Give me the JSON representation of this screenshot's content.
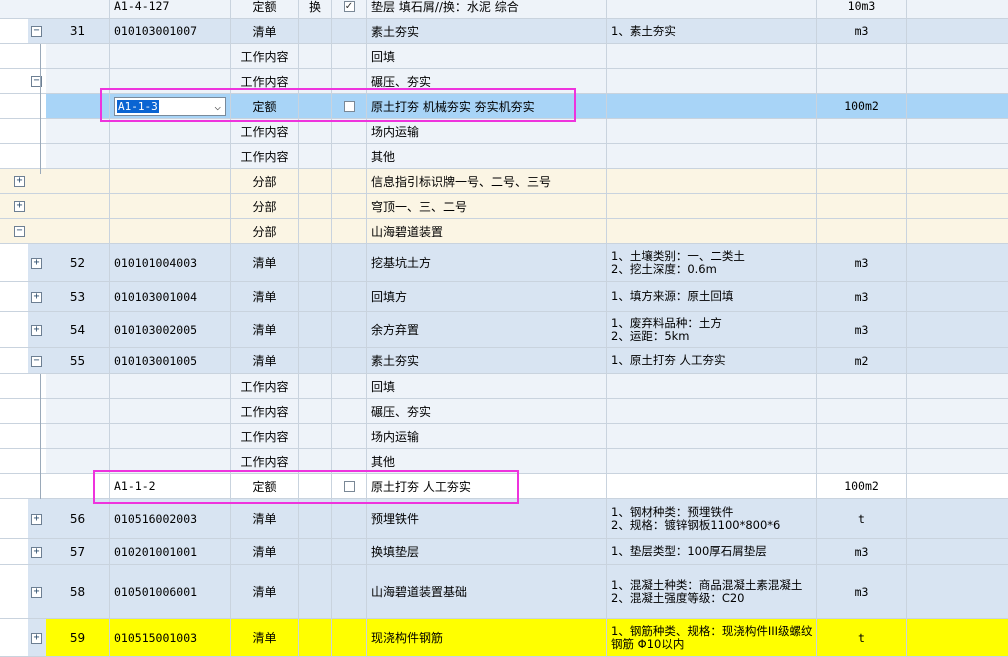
{
  "rows": [
    {
      "seq": "",
      "code": "A1-4-127",
      "type": "定额",
      "swap": "换",
      "checked": true,
      "name": "垫层 填石屑//换：水泥 综合",
      "feat": [
        "",
        ""
      ],
      "unit": "10m3"
    },
    {
      "seq": "31",
      "code": "010103001007",
      "type": "清单",
      "swap": "",
      "name": "素土夯实",
      "feat": [
        "1、素土夯实",
        ""
      ],
      "unit": "m3"
    },
    {
      "type": "工作内容",
      "name": "回填"
    },
    {
      "type": "工作内容",
      "name": "碾压、夯实"
    },
    {
      "combo": "A1-1-3",
      "type": "定额",
      "checked": false,
      "name": "原土打夯 机械夯实 夯实机夯实",
      "unit": "100m2"
    },
    {
      "type": "工作内容",
      "name": "场内运输"
    },
    {
      "type": "工作内容",
      "name": "其他"
    },
    {
      "type": "分部",
      "name": "信息指引标识牌一号、二号、三号"
    },
    {
      "type": "分部",
      "name": "穹顶一、三、二号"
    },
    {
      "type": "分部",
      "name": "山海碧道装置"
    },
    {
      "seq": "52",
      "code": "010101004003",
      "type": "清单",
      "name": "挖基坑土方",
      "feat": [
        "1、土壤类别：一、二类土",
        "2、挖土深度：0.6m"
      ],
      "unit": "m3"
    },
    {
      "seq": "53",
      "code": "010103001004",
      "type": "清单",
      "name": "回填方",
      "feat": [
        "1、填方来源：原土回填",
        ""
      ],
      "unit": "m3"
    },
    {
      "seq": "54",
      "code": "010103002005",
      "type": "清单",
      "name": "余方弃置",
      "feat": [
        "1、废弃料品种：土方",
        "2、运距：5km"
      ],
      "unit": "m3"
    },
    {
      "seq": "55",
      "code": "010103001005",
      "type": "清单",
      "name": "素土夯实",
      "feat": [
        "1、原土打夯 人工夯实",
        ""
      ],
      "unit": "m2"
    },
    {
      "type": "工作内容",
      "name": "回填"
    },
    {
      "type": "工作内容",
      "name": "碾压、夯实"
    },
    {
      "type": "工作内容",
      "name": "场内运输"
    },
    {
      "type": "工作内容",
      "name": "其他"
    },
    {
      "code": "A1-1-2",
      "type": "定额",
      "checked": false,
      "name": "原土打夯 人工夯实",
      "unit": "100m2"
    },
    {
      "seq": "56",
      "code": "010516002003",
      "type": "清单",
      "name": "预埋铁件",
      "feat": [
        "1、钢材种类：预埋铁件",
        "2、规格：镀锌钢板1100*800*6"
      ],
      "unit": "t"
    },
    {
      "seq": "57",
      "code": "010201001001",
      "type": "清单",
      "name": "换填垫层",
      "feat": [
        "1、垫层类型：100厚石屑垫层",
        ""
      ],
      "unit": "m3"
    },
    {
      "seq": "58",
      "code": "010501006001",
      "type": "清单",
      "name": "山海碧道装置基础",
      "feat": [
        "1、混凝土种类：商品混凝土素混凝土",
        "2、混凝土强度等级：C20"
      ],
      "unit": "m3"
    },
    {
      "seq": "59",
      "code": "010515001003",
      "type": "清单",
      "name": "现浇构件钢筋",
      "feat": [
        "1、钢筋种类、规格：现浇构件III级螺纹钢筋 Φ10以内",
        ""
      ],
      "unit": "t"
    }
  ],
  "toggles": {
    "plus": "+",
    "minus": "−"
  },
  "check_mark": "✓",
  "chevron": "⌵"
}
